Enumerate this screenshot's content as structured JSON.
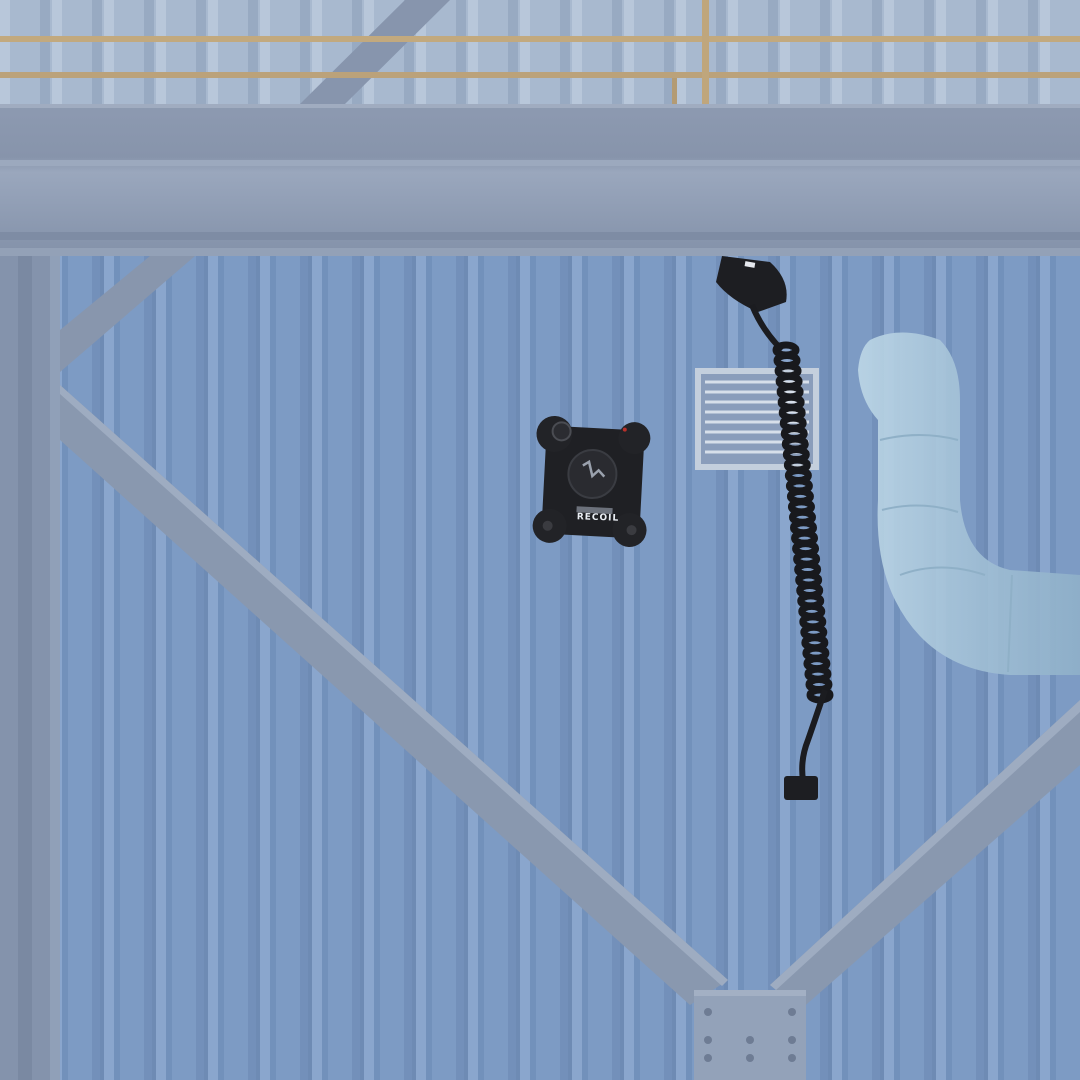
{
  "scene": {
    "description_hidden": "",
    "palette": {
      "wall": "#7d9bc4",
      "wall_rib_dark": "#6f8cb6",
      "wall_rib_light": "#8aa6cd",
      "steel": "#8e9db4",
      "steel_dark": "#77879f",
      "railing": "#c2a97e",
      "device": "#1f2024",
      "duct": "#a9c6da"
    },
    "device": {
      "brand_label": "RECOIL"
    },
    "icons": [
      "speaker-device-icon",
      "wall-vent-icon",
      "coiled-cable-icon",
      "duct-pipe-icon"
    ]
  }
}
